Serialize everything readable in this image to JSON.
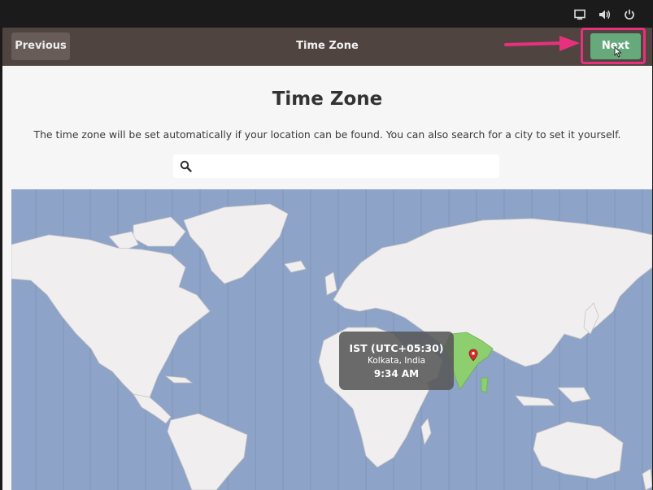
{
  "system_tray": {
    "icons": [
      "display-icon",
      "volume-icon",
      "power-icon"
    ]
  },
  "header": {
    "previous_label": "Previous",
    "title": "Time Zone",
    "next_label": "Next"
  },
  "main": {
    "title": "Time Zone",
    "description": "The time zone will be set automatically if your location can be found. You can also search for a city to set it yourself.",
    "search": {
      "value": "",
      "placeholder": ""
    }
  },
  "map": {
    "selected": {
      "abbr": "IST (UTC+05:30)",
      "city": "Kolkata, India",
      "time": "9:34 AM"
    }
  },
  "colors": {
    "headerbar": "#4f4440",
    "next_button": "#66a97b",
    "highlight": "#e8317d",
    "ocean": "#8da3c7",
    "land": "#f0eeee",
    "selected_zone": "#8dcf6f"
  }
}
